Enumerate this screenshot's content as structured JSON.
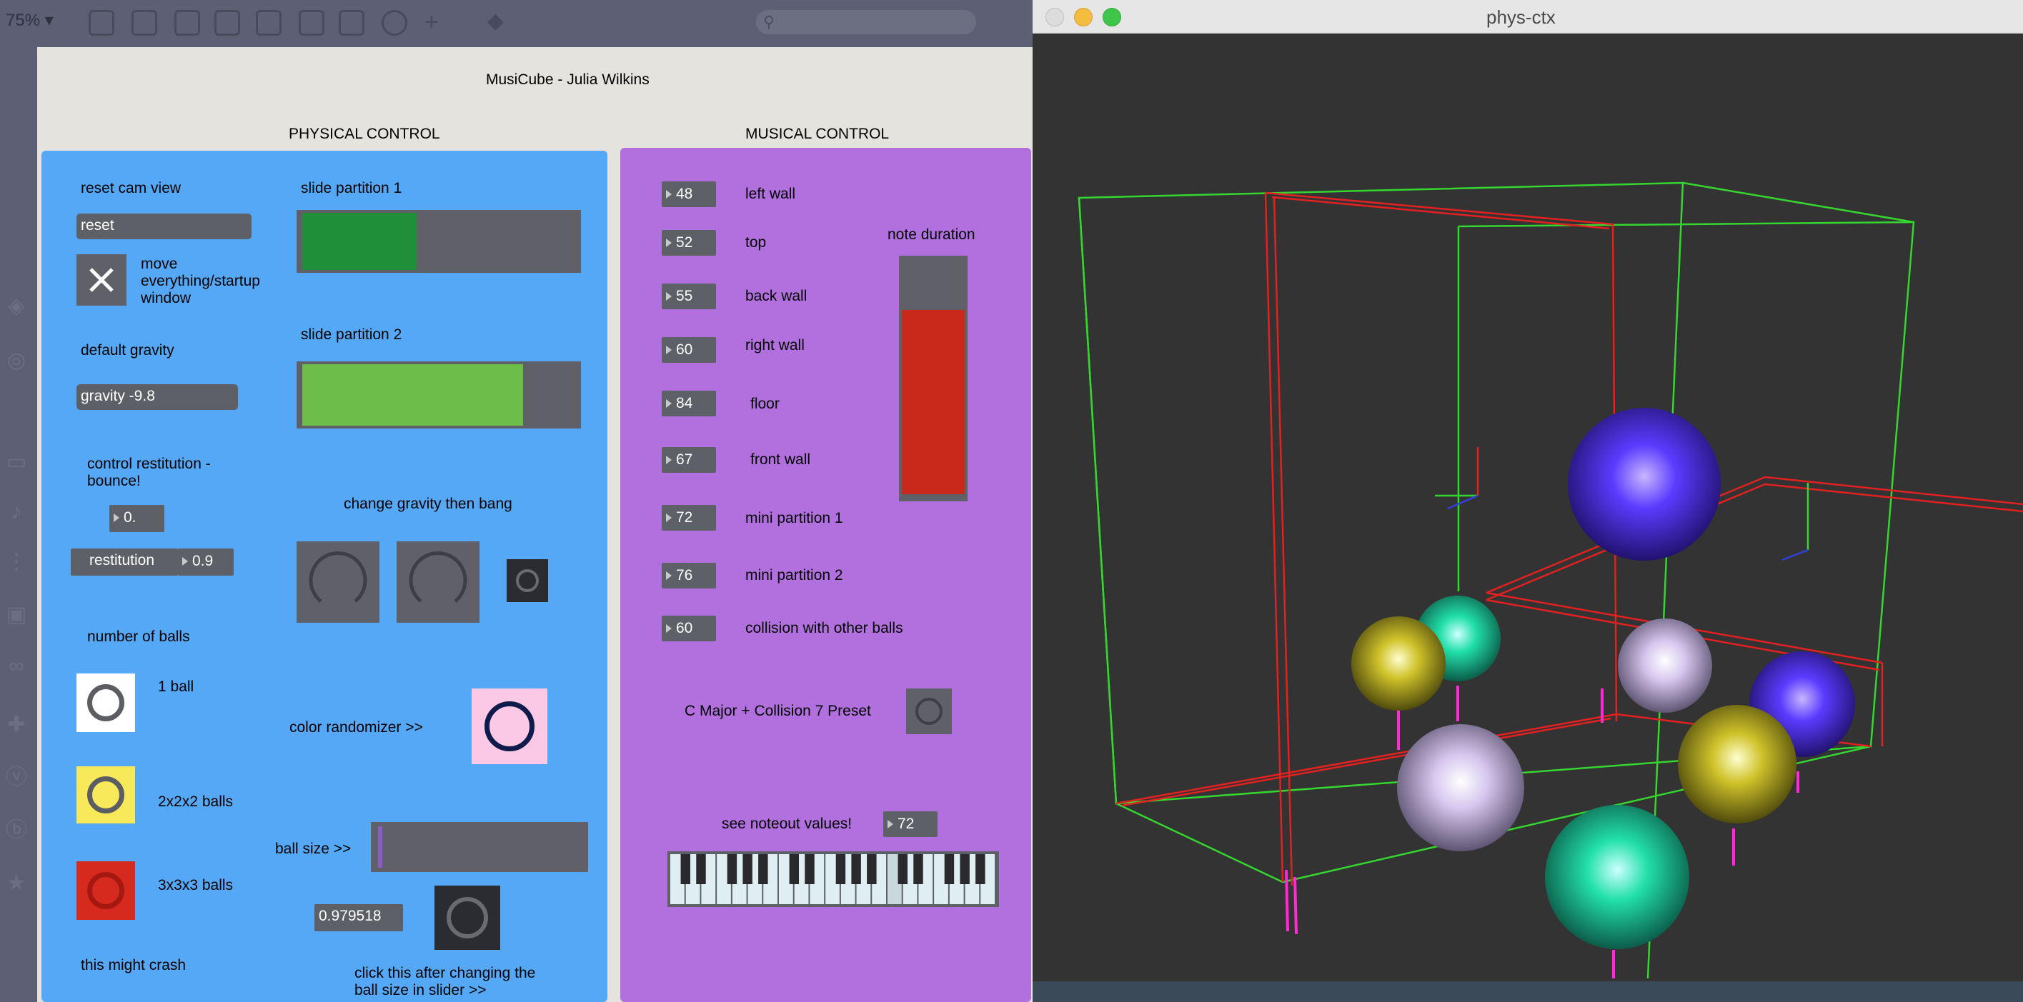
{
  "toolbar": {
    "zoom": "75% ▾"
  },
  "patcher": {
    "title": "MusiCube - Julia Wilkins",
    "physical_title": "PHYSICAL CONTROL",
    "musical_title": "MUSICAL CONTROL"
  },
  "physical": {
    "reset_cam_label": "reset cam view",
    "reset_button": "reset",
    "move_label": "move everything/startup window",
    "slide1_label": "slide partition 1",
    "slide1_value": 0.42,
    "slide2_label": "slide partition 2",
    "slide2_value": 0.81,
    "default_gravity_label": "default gravity",
    "gravity_message": "gravity -9.8",
    "restitution_label": "control restitution - bounce!",
    "restitution_input": "0.",
    "restitution_message": "restitution",
    "restitution_value": "0.9",
    "change_gravity_label": "change gravity then bang",
    "num_balls_label": "number of balls",
    "ball1_label": "1 ball",
    "ball2_label": "2x2x2 balls",
    "ball3_label": "3x3x3 balls",
    "color_randomizer_label": "color randomizer >>",
    "ball_size_label": "ball size >>",
    "ball_size_value": "0.979518",
    "click_after_label": "click this after changing the ball size in slider >>",
    "crash_label": "this might crash",
    "colors": {
      "ball1": "#ffffff",
      "ball2": "#f7e95a",
      "ball3": "#d62a1e",
      "randomizer": "#fbc9e6"
    }
  },
  "musical": {
    "notes": [
      {
        "value": "48",
        "label": "left wall"
      },
      {
        "value": "52",
        "label": "top"
      },
      {
        "value": "55",
        "label": "back wall"
      },
      {
        "value": "60",
        "label": "right wall"
      },
      {
        "value": "84",
        "label": "floor"
      },
      {
        "value": "67",
        "label": "front wall"
      },
      {
        "value": "72",
        "label": "mini partition 1"
      },
      {
        "value": "76",
        "label": "mini partition 2"
      },
      {
        "value": "60",
        "label": "collision with other balls"
      }
    ],
    "note_duration_label": "note duration",
    "note_duration_level": 0.79,
    "preset_label": "C Major + Collision 7 Preset",
    "noteout_label": "see noteout values!",
    "noteout_value": "72"
  },
  "ctx_window": {
    "title": "phys-ctx"
  }
}
